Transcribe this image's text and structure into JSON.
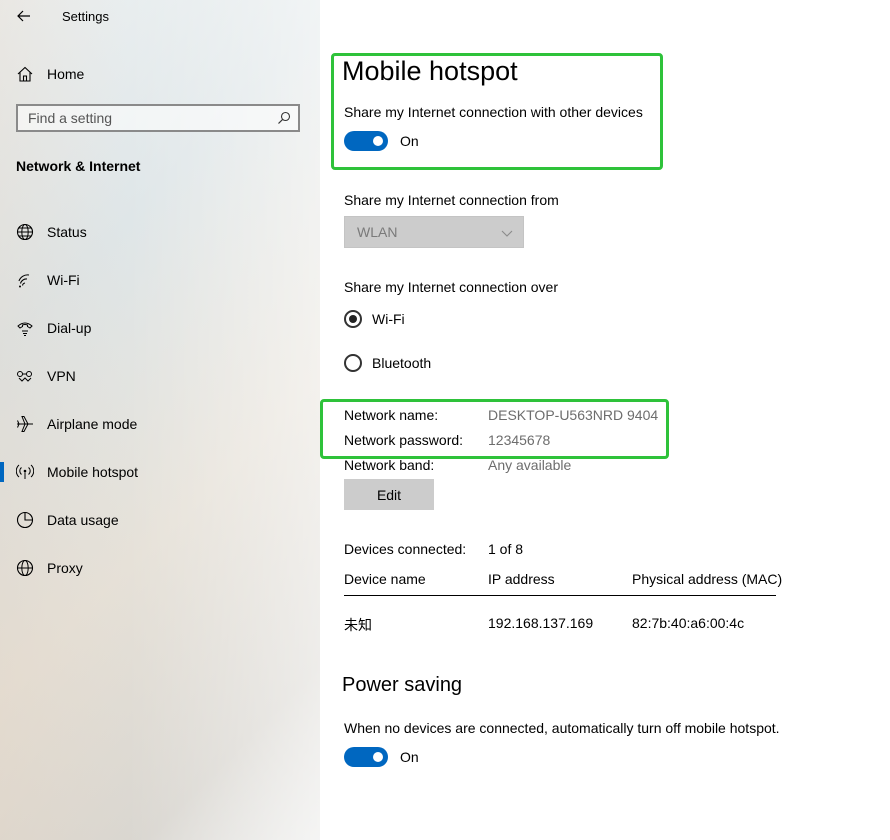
{
  "window": {
    "title": "Settings"
  },
  "sidebar": {
    "home_label": "Home",
    "search_placeholder": "Find a setting",
    "section_title": "Network & Internet",
    "items": [
      {
        "label": "Status",
        "icon": "globe-icon"
      },
      {
        "label": "Wi-Fi",
        "icon": "wifi-icon"
      },
      {
        "label": "Dial-up",
        "icon": "dialup-icon"
      },
      {
        "label": "VPN",
        "icon": "vpn-icon"
      },
      {
        "label": "Airplane mode",
        "icon": "airplane-icon"
      },
      {
        "label": "Mobile hotspot",
        "icon": "hotspot-icon",
        "active": true
      },
      {
        "label": "Data usage",
        "icon": "data-usage-icon"
      },
      {
        "label": "Proxy",
        "icon": "proxy-globe-icon"
      }
    ]
  },
  "main": {
    "title": "Mobile hotspot",
    "share_label": "Share my Internet connection with other devices",
    "share_toggle": "On",
    "from_label": "Share my Internet connection from",
    "from_value": "WLAN",
    "over_label": "Share my Internet connection over",
    "over_options": [
      "Wi-Fi",
      "Bluetooth"
    ],
    "over_selected": "Wi-Fi",
    "network": {
      "name_label": "Network name:",
      "name_value": "DESKTOP-U563NRD 9404",
      "password_label": "Network password:",
      "password_value": "12345678",
      "band_label": "Network band:",
      "band_value": "Any available"
    },
    "edit_label": "Edit",
    "devices_label": "Devices connected:",
    "devices_value": "1 of 8",
    "table": {
      "headers": [
        "Device name",
        "IP address",
        "Physical address (MAC)"
      ],
      "rows": [
        [
          "未知",
          "192.168.137.169",
          "82:7b:40:a6:00:4c"
        ]
      ]
    },
    "power_title": "Power saving",
    "power_label": "When no devices are connected, automatically turn off mobile hotspot.",
    "power_toggle": "On"
  },
  "colors": {
    "accent": "#0067c0",
    "highlight": "#2ec23a"
  }
}
